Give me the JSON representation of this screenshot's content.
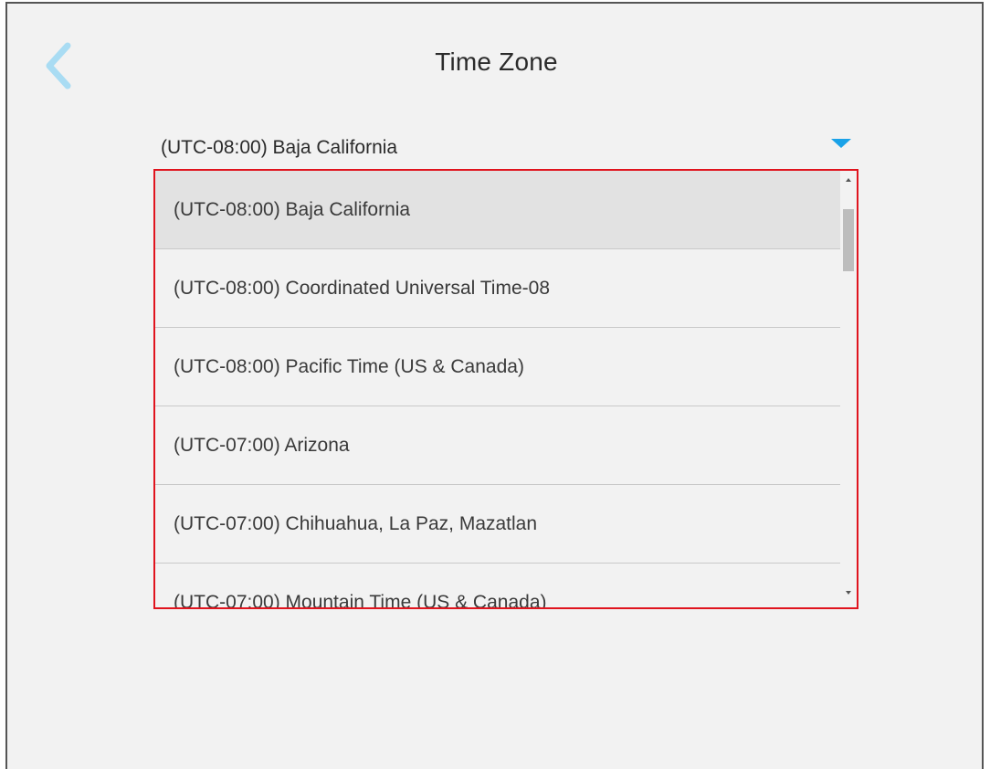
{
  "header": {
    "title": "Time Zone",
    "back_icon": "chevron-left-icon"
  },
  "colors": {
    "accent": "#1aa2e8",
    "highlight_border": "#e0141e",
    "back_chevron": "#a9dcf3"
  },
  "timezone_select": {
    "selected_value": "(UTC-08:00) Baja California",
    "options": [
      "(UTC-08:00) Baja California",
      "(UTC-08:00) Coordinated Universal Time-08",
      "(UTC-08:00) Pacific Time (US & Canada)",
      "(UTC-07:00) Arizona",
      "(UTC-07:00) Chihuahua, La Paz, Mazatlan",
      "(UTC-07:00) Mountain Time (US & Canada)"
    ],
    "highlighted_index": 0
  }
}
